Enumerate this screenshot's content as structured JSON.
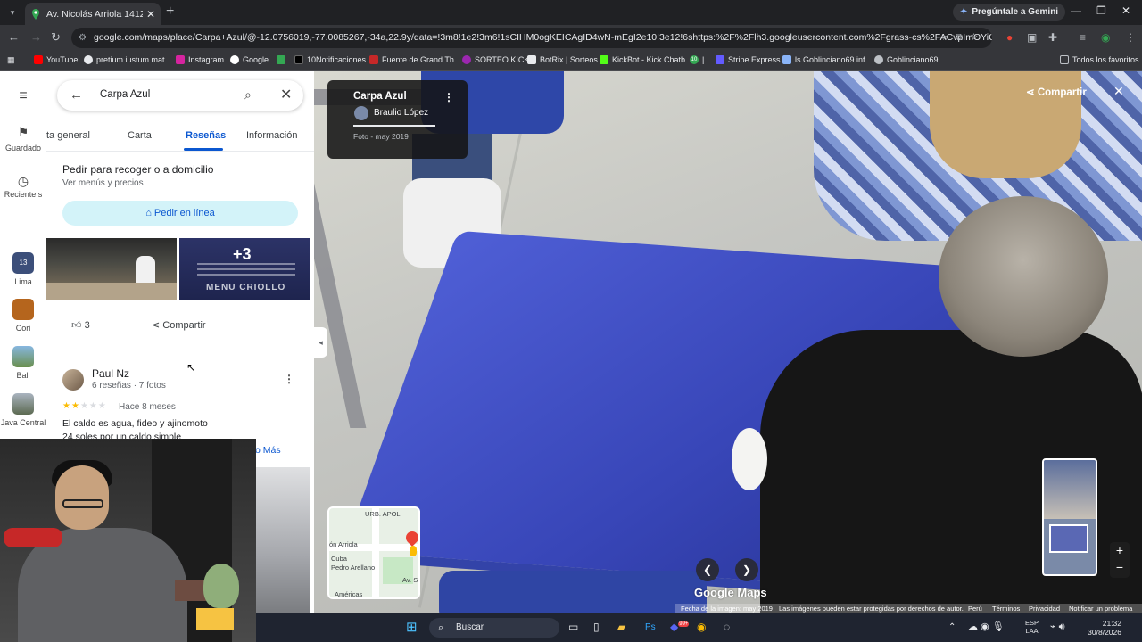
{
  "browser": {
    "tab_title": "Av. Nicolás Arriola 1412, San Lu",
    "gemini_label": "Pregúntale a Gemini",
    "url": "google.com/maps/place/Carpa+Azul/@-12.0756019,-77.0085267,-34a,22.9y/data=!3m8!1e2!3m6!1sCIHM0ogKEICAgID4wN-mEgI2e10!3e12!6shttps:%2F%2Flh3.googleusercontent.com%2Fgrass-cs%2FACvpImOYiCjqvNqs8R6O...",
    "bookmarks": [
      "YouTube",
      "pretium iustum mat...",
      "Instagram",
      "Google",
      "10Notificaciones",
      "Fuente de Grand Th...",
      "SORTEO KICK",
      "BotRix | Sorteos",
      "KickBot - Kick Chatb...",
      "10",
      "Stripe Express",
      "ls Goblinciano69 inf...",
      "Goblinciano69"
    ],
    "all_favorites": "Todos los favoritos"
  },
  "rail": {
    "saved": "Guardado",
    "recent": "Reciente s",
    "places": [
      "Lima",
      "Cori",
      "Bali",
      "Java Central"
    ],
    "lima_badge": "13"
  },
  "panel": {
    "search_query": "Carpa Azul",
    "tabs": [
      "ta general",
      "Carta",
      "Reseñas",
      "Información"
    ],
    "order_title": "Pedir para recoger o a domicilio",
    "order_sub": "Ver menús y precios",
    "order_button": "Pedir en línea",
    "more_photos": "+3",
    "menu_text": "MENU CRIOLLO",
    "likes": "3",
    "share": "Compartir",
    "review": {
      "author": "Paul Nz",
      "meta": "6 reseñas · 7 fotos",
      "rating": 2,
      "when": "Hace 8 meses",
      "text1": "El caldo es agua, fideo y ajinomoto",
      "text2": "24 soles por un caldo simple",
      "more": "o Más"
    }
  },
  "streetview": {
    "card_title": "Carpa Azul",
    "card_author": "Braulio López",
    "card_date": "Foto - may 2019",
    "share": "Compartir",
    "logo": "Google Maps",
    "footer": [
      "Fecha de la imagen: may 2019",
      "Las imágenes pueden estar protegidas por derechos de autor.",
      "Perú",
      "Términos",
      "Privacidad",
      "Notificar un problema"
    ],
    "minimap_labels": [
      "URB. APOL",
      "ón Arriola",
      "Cuba",
      "Pedro Arellano",
      "Américas",
      "Av. S"
    ]
  },
  "taskbar": {
    "search": "Buscar",
    "lang1": "ESP",
    "lang2": "LAA",
    "time": "21:32",
    "date": "30/8/2026",
    "discord_badge": "99+"
  },
  "colors": {
    "accent": "#0b57d0",
    "order_bg": "#d3f3f9",
    "table_blue": "#3846b8",
    "star": "#fbbc04"
  }
}
